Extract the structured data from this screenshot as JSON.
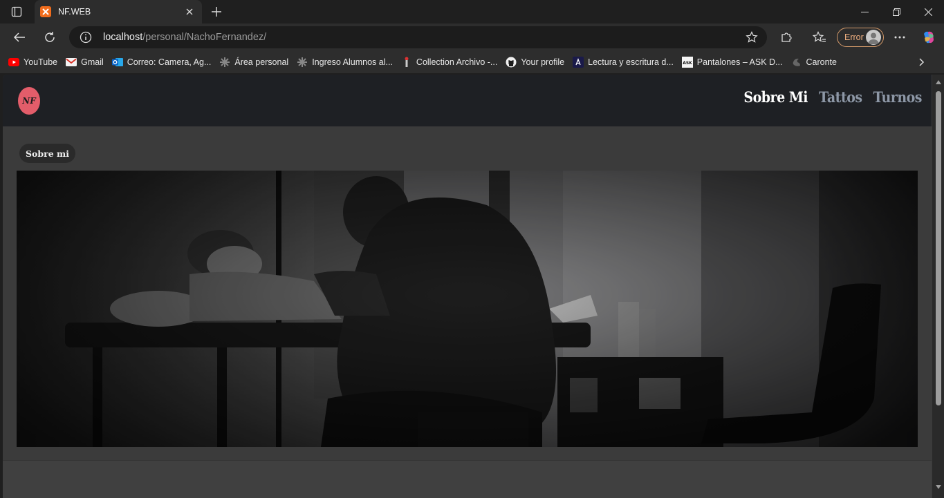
{
  "browser": {
    "tab": {
      "title": "NF.WEB"
    },
    "address": {
      "host": "localhost",
      "path": "/personal/NachoFernandez/"
    },
    "profile": {
      "label": "Error"
    },
    "bookmarks": [
      {
        "label": "YouTube",
        "icon": "youtube-icon"
      },
      {
        "label": "Gmail",
        "icon": "gmail-icon"
      },
      {
        "label": "Correo: Camera, Ag...",
        "icon": "outlook-icon"
      },
      {
        "label": "Área personal",
        "icon": "moodle-icon"
      },
      {
        "label": "Ingreso Alumnos al...",
        "icon": "moodle-icon"
      },
      {
        "label": "Collection Archivo -...",
        "icon": "archive-icon"
      },
      {
        "label": "Your profile",
        "icon": "github-icon"
      },
      {
        "label": "Lectura y escritura d...",
        "icon": "angular-icon"
      },
      {
        "label": "Pantalones – ASK D...",
        "icon": "ask-icon"
      },
      {
        "label": "Caronte",
        "icon": "caronte-icon"
      }
    ]
  },
  "site": {
    "logo_text": "NF",
    "nav": [
      {
        "label": "Sobre Mi",
        "active": true
      },
      {
        "label": "Tattos",
        "active": false
      },
      {
        "label": "Turnos",
        "active": false
      }
    ],
    "section_label": "Sobre mi",
    "hero_image": "tattoo-artist-working-photo"
  },
  "colors": {
    "browser_bg": "#1f1f1f",
    "toolbar_bg": "#2d2d2d",
    "site_header_bg": "#1e2024",
    "page_bg": "#3b3b3b",
    "logo_accent": "#e35d6a",
    "profile_accent": "#d49a6a"
  }
}
